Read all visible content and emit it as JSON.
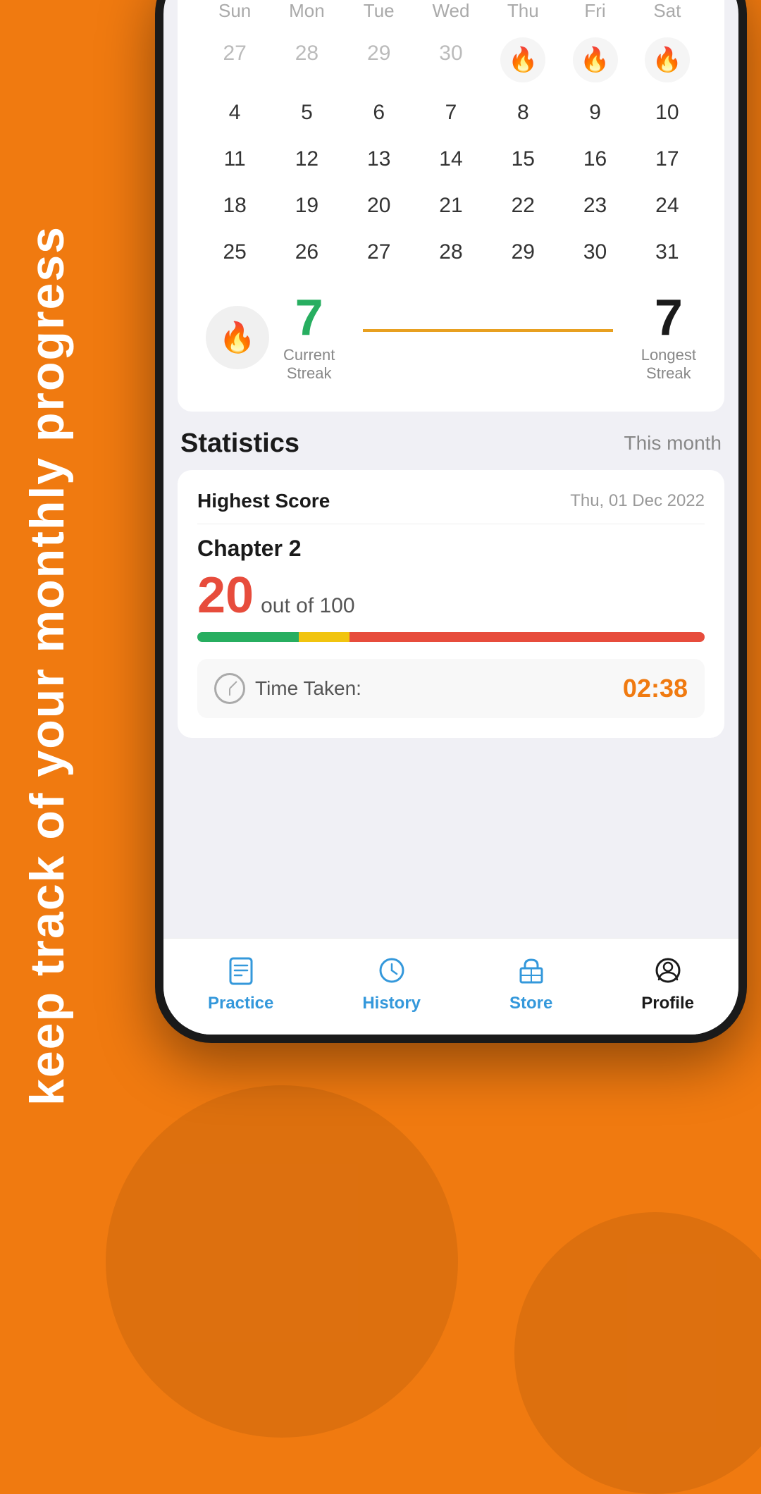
{
  "background": {
    "color": "#F07A10",
    "tagline": "keep track of your monthly progress"
  },
  "calendar": {
    "headers": [
      "Sun",
      "Mon",
      "Tue",
      "Wed",
      "Thu",
      "Fri",
      "Sat"
    ],
    "rows": [
      [
        {
          "day": "27",
          "muted": true
        },
        {
          "day": "28",
          "muted": true
        },
        {
          "day": "29",
          "muted": true
        },
        {
          "day": "30",
          "muted": true
        },
        {
          "day": "",
          "fire": true
        },
        {
          "day": "",
          "fire": true
        },
        {
          "day": "",
          "fire": true
        }
      ],
      [
        {
          "day": "4"
        },
        {
          "day": "5"
        },
        {
          "day": "6"
        },
        {
          "day": "7"
        },
        {
          "day": "8"
        },
        {
          "day": "9"
        },
        {
          "day": "10"
        }
      ],
      [
        {
          "day": "11"
        },
        {
          "day": "12"
        },
        {
          "day": "13"
        },
        {
          "day": "14"
        },
        {
          "day": "15"
        },
        {
          "day": "16"
        },
        {
          "day": "17"
        }
      ],
      [
        {
          "day": "18"
        },
        {
          "day": "19"
        },
        {
          "day": "20"
        },
        {
          "day": "21"
        },
        {
          "day": "22"
        },
        {
          "day": "23"
        },
        {
          "day": "24"
        }
      ],
      [
        {
          "day": "25"
        },
        {
          "day": "26"
        },
        {
          "day": "27"
        },
        {
          "day": "28"
        },
        {
          "day": "29"
        },
        {
          "day": "30"
        },
        {
          "day": "31"
        }
      ]
    ]
  },
  "streak": {
    "current_value": "7",
    "current_label": "Current\nStreak",
    "longest_value": "7",
    "longest_label": "Longest\nStreak"
  },
  "statistics": {
    "title": "Statistics",
    "period": "This month",
    "highest_score_label": "Highest Score",
    "date": "Thu, 01 Dec 2022",
    "chapter": "Chapter 2",
    "score": "20",
    "score_out_of": "out of 100",
    "time_taken_label": "Time Taken:",
    "time_value": "02:38"
  },
  "nav": {
    "items": [
      {
        "label": "Practice",
        "icon": "practice-icon",
        "active": false
      },
      {
        "label": "History",
        "icon": "history-icon",
        "active": false
      },
      {
        "label": "Store",
        "icon": "store-icon",
        "active": false
      },
      {
        "label": "Profile",
        "icon": "profile-icon",
        "active": true
      }
    ]
  }
}
